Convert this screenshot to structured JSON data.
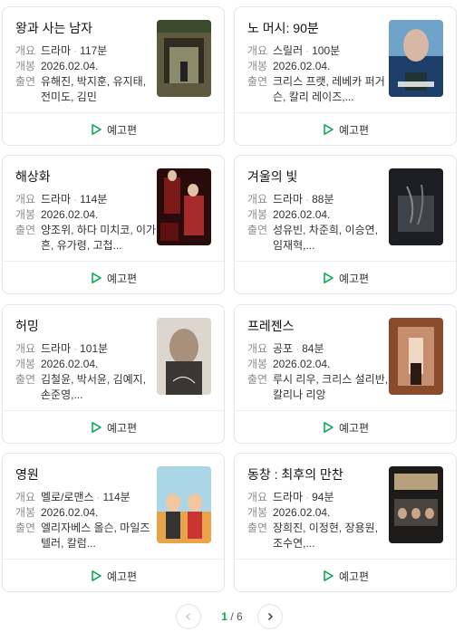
{
  "labels": {
    "genre": "개요",
    "release": "개봉",
    "cast": "출연",
    "trailer": "예고편"
  },
  "movies": [
    {
      "title": "왕과 사는 남자",
      "genre": "드라마",
      "runtime": "117분",
      "release": "2026.02.04.",
      "cast": "유해진, 박지훈, 유지태, 전미도, 김민"
    },
    {
      "title": "노 머시: 90분",
      "genre": "스릴러",
      "runtime": "100분",
      "release": "2026.02.04.",
      "cast": "크리스 프랫, 레베카 퍼거슨, 칼리 레이즈,..."
    },
    {
      "title": "해상화",
      "genre": "드라마",
      "runtime": "114분",
      "release": "2026.02.04.",
      "cast": "양조위, 하다 미치코, 이가흔, 유가령, 고첩..."
    },
    {
      "title": "겨울의 빛",
      "genre": "드라마",
      "runtime": "88분",
      "release": "2026.02.04.",
      "cast": "성유빈, 차준희, 이승연, 임재혁,..."
    },
    {
      "title": "허밍",
      "genre": "드라마",
      "runtime": "101분",
      "release": "2026.02.04.",
      "cast": "김철윤, 박서윤, 김예지, 손준영,..."
    },
    {
      "title": "프레젠스",
      "genre": "공포",
      "runtime": "84분",
      "release": "2026.02.04.",
      "cast": "루시 리우, 크리스 설리반, 칼리나 리앙"
    },
    {
      "title": "영원",
      "genre": "멜로/로맨스",
      "runtime": "114분",
      "release": "2026.02.04.",
      "cast": "엘리자베스 올슨, 마일즈 텔러, 칼럼..."
    },
    {
      "title": "동창 : 최후의 만찬",
      "genre": "드라마",
      "runtime": "94분",
      "release": "2026.02.04.",
      "cast": "장희진, 이정현, 장용원, 조수연,..."
    }
  ],
  "pagination": {
    "current": "1",
    "separator": "/",
    "total": "6"
  },
  "colors": {
    "accent": "#03a94d",
    "border": "#e3e5e8"
  }
}
